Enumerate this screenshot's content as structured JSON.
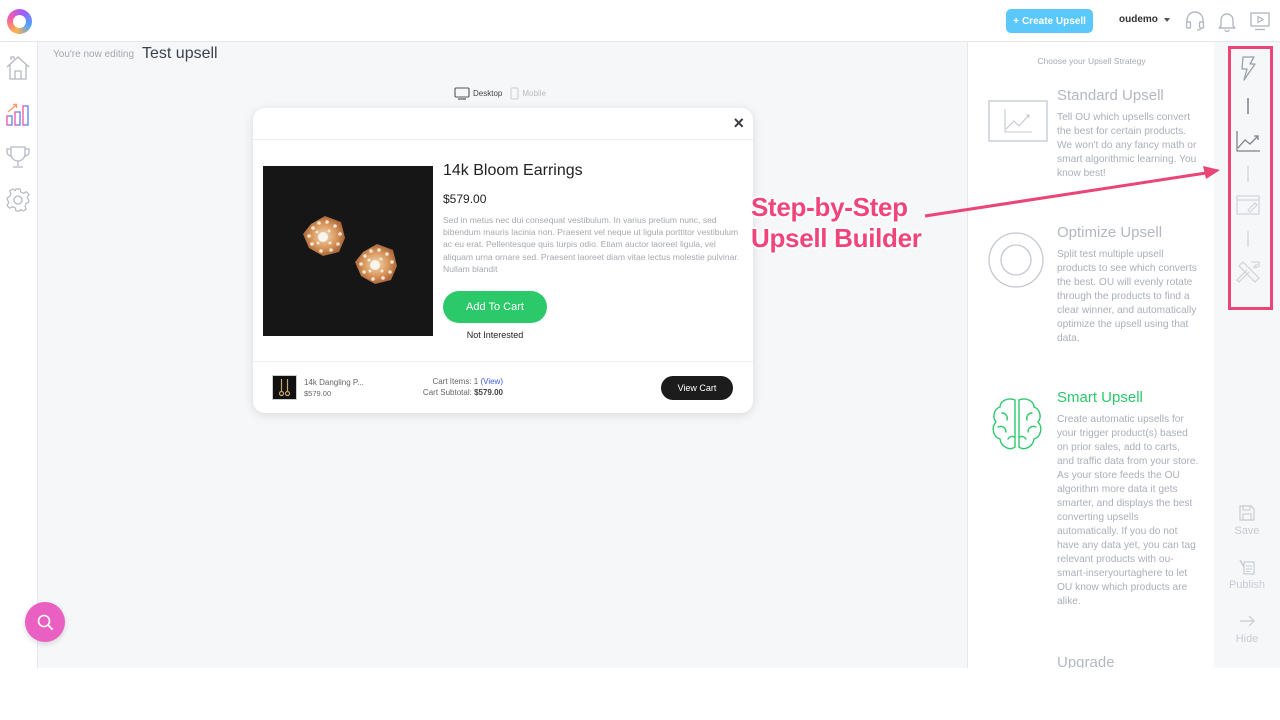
{
  "topbar": {
    "logo": "optimizeupsell-logo",
    "create_button": {
      "icon": "+",
      "label": "Create Upsell"
    },
    "user": {
      "name": "oudemo",
      "icon": "chevron-down-icon"
    },
    "icons": [
      "headset-icon",
      "bell-icon",
      "video-tutorial-icon"
    ]
  },
  "leftbar": {
    "items": [
      {
        "name": "home",
        "icon": "home-icon",
        "active": false
      },
      {
        "name": "analytics",
        "icon": "bar-chart-icon",
        "active": true
      },
      {
        "name": "rewards",
        "icon": "trophy-icon",
        "active": false
      },
      {
        "name": "settings",
        "icon": "gear-icon",
        "active": false
      }
    ]
  },
  "editor": {
    "editing_label": "You're now editing",
    "title": "Test upsell",
    "devices": [
      {
        "label": "Desktop",
        "icon": "desktop-icon",
        "active": true
      },
      {
        "label": "Mobile",
        "icon": "mobile-icon",
        "active": false
      }
    ]
  },
  "popup": {
    "close_icon": "×",
    "product": {
      "title": "14k Bloom Earrings",
      "price": "$579.00",
      "description": "Sed in metus nec dui consequat vestibulum. In varius pretium nunc, sed bibendum mauris lacinia non. Praesent vel neque ut ligula porttitor vestibulum ac eu erat. Pellentesque quis turpis odio. Etiam auctor laoreet ligula, vel aliquam urna ornare sed. Praesent laoreet diam vitae lectus molestie pulvinar. Nullam blandit",
      "add_to_cart": "Add To Cart",
      "not_interested": "Not Interested"
    },
    "cart": {
      "item_name": "14k Dangling P...",
      "item_price": "$579.00",
      "items_label": "Cart Items: 1",
      "view_link": "(View)",
      "subtotal_label": "Cart Subtotal:",
      "subtotal_value": "$579.00",
      "view_cart": "View Cart"
    }
  },
  "annotation": {
    "line1": "Step-by-Step",
    "line2": "Upsell Builder",
    "color": "#ea4577"
  },
  "strategy": {
    "heading": "Choose your Upsell Strategy",
    "options": [
      {
        "title": "Standard Upsell",
        "icon": "line-chart-icon",
        "active": false,
        "description": "Tell OU which upsells convert the best for certain products. We won't do any fancy math or smart algorithmic learning. You know best!"
      },
      {
        "title": "Optimize Upsell",
        "icon": "target-circle-icon",
        "active": false,
        "description": "Split test multiple upsell products to see which converts the best. OU will evenly rotate through the products to find a clear winner, and automatically optimize the upsell using that data."
      },
      {
        "title": "Smart Upsell",
        "icon": "brain-icon",
        "active": true,
        "description": "Create automatic upsells for your trigger product(s) based on prior sales, add to carts, and traffic data from your store. As your store feeds the OU algorithm more data it gets smarter, and displays the best converting upsells automatically. If you do not have any data yet, you can tag relevant products with ou-smart-inseryourtaghere to let OU know which products are alike."
      },
      {
        "title": "Upgrade",
        "icon": "upgrade-icon",
        "active": false,
        "description": ""
      }
    ]
  },
  "rail": {
    "steps": [
      {
        "name": "trigger",
        "icon": "lightning-icon",
        "state": "done"
      },
      {
        "name": "strategy",
        "icon": "line-chart-icon",
        "state": "current"
      },
      {
        "name": "design",
        "icon": "design-canvas-icon",
        "state": "pending"
      },
      {
        "name": "settings",
        "icon": "tools-icon",
        "state": "pending"
      }
    ],
    "actions": [
      {
        "label": "Save",
        "icon": "save-icon"
      },
      {
        "label": "Publish",
        "icon": "publish-icon"
      },
      {
        "label": "Hide",
        "icon": "arrow-right-icon"
      }
    ]
  },
  "fab": {
    "icon": "search-icon"
  }
}
